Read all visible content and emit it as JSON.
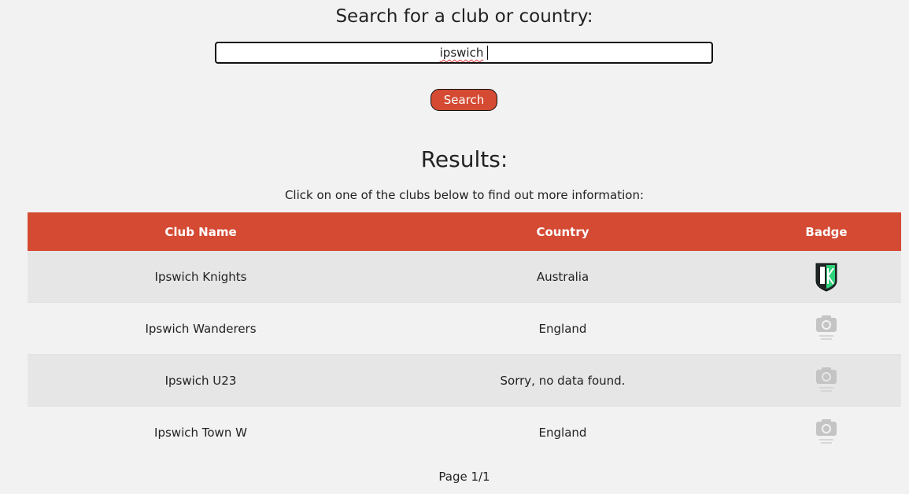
{
  "search": {
    "heading": "Search for a club or country:",
    "value": "ipswich",
    "button_label": "Search"
  },
  "results": {
    "title": "Results:",
    "subtitle": "Click on one of the clubs below to find out more information:",
    "columns": [
      "Club Name",
      "Country",
      "Badge"
    ],
    "rows": [
      {
        "club": "Ipswich Knights",
        "country": "Australia",
        "badge_icon": "ipswich-knights-badge"
      },
      {
        "club": "Ipswich Wanderers",
        "country": "England",
        "badge_icon": "image-not-available-icon"
      },
      {
        "club": "Ipswich U23",
        "country": "Sorry, no data found.",
        "badge_icon": "image-not-available-icon"
      },
      {
        "club": "Ipswich Town W",
        "country": "England",
        "badge_icon": "image-not-available-icon"
      }
    ],
    "pagination": "Page 1/1"
  },
  "colors": {
    "accent": "#d44a33",
    "background": "#f2f2f2",
    "row_alt": "#e6e6e6"
  }
}
